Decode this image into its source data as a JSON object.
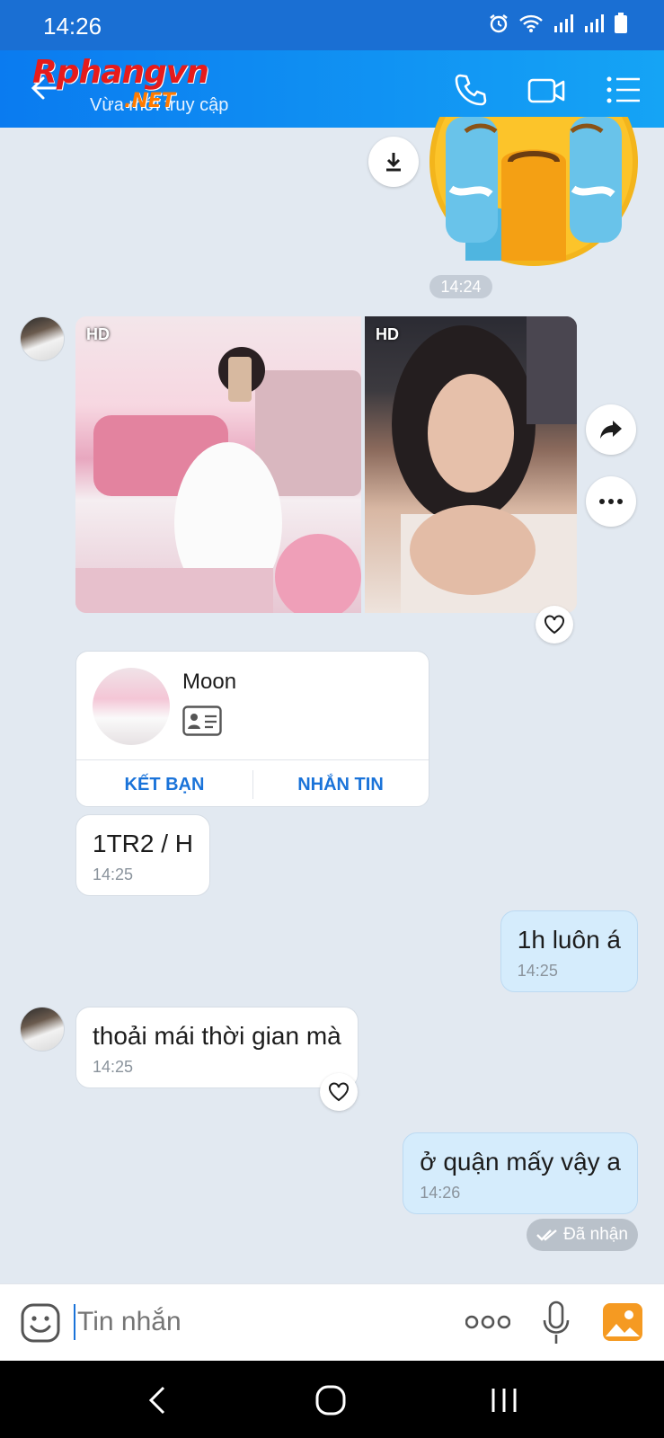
{
  "status_bar": {
    "time": "14:26"
  },
  "header": {
    "watermark": "Rphangvn",
    "watermark_sub": ".NET",
    "contact_status": "Vừa mới truy cập"
  },
  "chat": {
    "time_separator": "14:24",
    "photos": [
      {
        "badge": "HD"
      },
      {
        "badge": "HD"
      }
    ],
    "contact_card": {
      "name": "Moon",
      "add_friend_label": "KẾT BẠN",
      "message_label": "NHẮN TIN"
    },
    "messages": [
      {
        "text": "1TR2 / H",
        "time": "14:25",
        "from": "them"
      },
      {
        "text": "1h luôn á",
        "time": "14:25",
        "from": "me"
      },
      {
        "text": "thoải mái thời gian mà",
        "time": "14:25",
        "from": "them"
      },
      {
        "text": "ở quận mấy vậy a",
        "time": "14:26",
        "from": "me"
      }
    ],
    "delivery_status": "Đã nhận"
  },
  "input_bar": {
    "placeholder": "Tin nhắn"
  },
  "colors": {
    "header": "#0a7bf0",
    "accent": "#1a73d9",
    "my_bubble": "#d5ecfc",
    "chat_bg": "#e2e9f1"
  }
}
